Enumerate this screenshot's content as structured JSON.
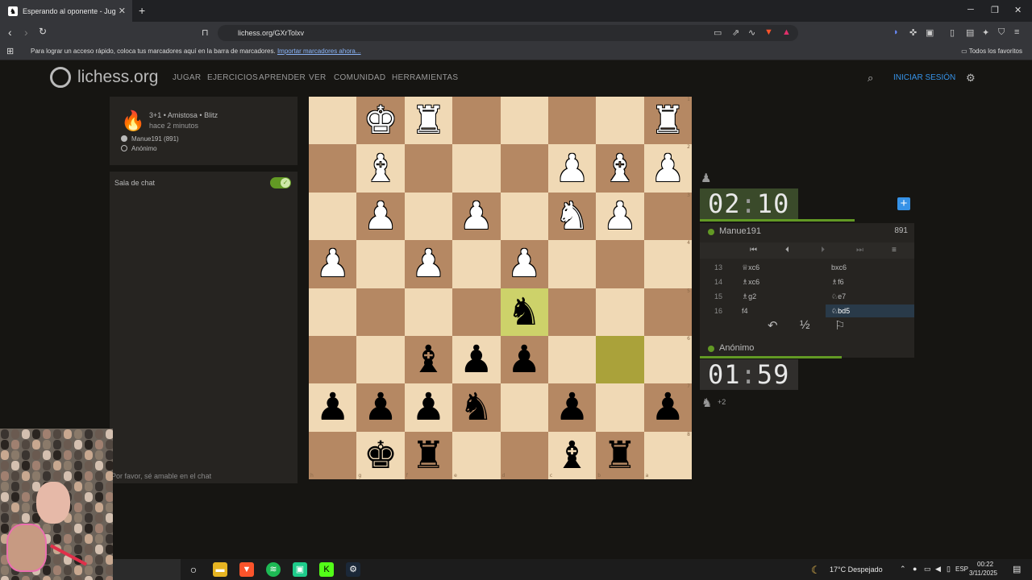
{
  "browser": {
    "tab_title": "Esperando al oponente - Jug",
    "url": "lichess.org/GXrTolxv",
    "bookmarks_hint": "Para lograr un acceso rápido, coloca tus marcadores aquí en la barra de marcadores.",
    "bookmarks_link": "Importar marcadores ahora...",
    "all_favorites": "Todos los favoritos"
  },
  "site": {
    "logo": "lichess.org",
    "nav": [
      "JUGAR",
      "EJERCICIOS",
      "APRENDER",
      "VER",
      "COMUNIDAD",
      "HERRAMIENTAS"
    ],
    "login": "INICIAR SESIÓN"
  },
  "game_info": {
    "mode": "3+1 • Amistosa • Blitz",
    "time_ago": "hace 2 minutos",
    "white_player": "Manue191 (891)",
    "black_player": "Anónimo"
  },
  "chat": {
    "title": "Sala de chat",
    "placeholder": "Por favor, sé amable en el chat"
  },
  "board": {
    "rows": [
      [
        "",
        "wK",
        "wR",
        "",
        "",
        "",
        "",
        "wR"
      ],
      [
        "",
        "wB",
        "",
        "",
        "",
        "wP",
        "wB",
        "wP"
      ],
      [
        "",
        "wP",
        "",
        "wP",
        "",
        "wN",
        "wP",
        ""
      ],
      [
        "wP",
        "",
        "wP",
        "",
        "wP",
        "",
        "",
        ""
      ],
      [
        "",
        "",
        "",
        "",
        "bN",
        "",
        "",
        ""
      ],
      [
        "",
        "",
        "bB",
        "bP",
        "bP",
        "",
        "",
        ""
      ],
      [
        "bP",
        "bP",
        "bP",
        "bN",
        "",
        "bP",
        "",
        "bP"
      ],
      [
        "",
        "bK",
        "bR",
        "",
        "",
        "bB",
        "bR",
        ""
      ]
    ],
    "highlights": [
      [
        4,
        4
      ],
      [
        5,
        6
      ]
    ],
    "rank_labels": [
      "1",
      "2",
      "3",
      "4",
      "5",
      "6",
      "7",
      "8"
    ],
    "file_labels": [
      "h",
      "g",
      "f",
      "e",
      "d",
      "c",
      "b",
      "a"
    ]
  },
  "clocks": {
    "top_minutes": "02",
    "top_seconds": "10",
    "bottom_minutes": "01",
    "bottom_seconds": "59",
    "top_remaining_fraction": 0.72,
    "bottom_remaining_fraction": 0.66
  },
  "players": {
    "top_name": "Manue191",
    "top_rating": "891",
    "bottom_name": "Anónimo",
    "material_diff": "+2"
  },
  "moves": [
    {
      "no": "13",
      "white": "♕xc6",
      "black": "bxc6"
    },
    {
      "no": "14",
      "white": "♗xc6",
      "black": "♗f6"
    },
    {
      "no": "15",
      "white": "♗g2",
      "black": "♘e7"
    },
    {
      "no": "16",
      "white": "f4",
      "black": "♘bd5"
    }
  ],
  "actions": {
    "takeback": "↶",
    "draw": "½",
    "resign": "⚐"
  },
  "taskbar": {
    "weather": "17°C Despejado",
    "lang": "ESP",
    "time": "00:22",
    "date": "3/11/2025"
  }
}
